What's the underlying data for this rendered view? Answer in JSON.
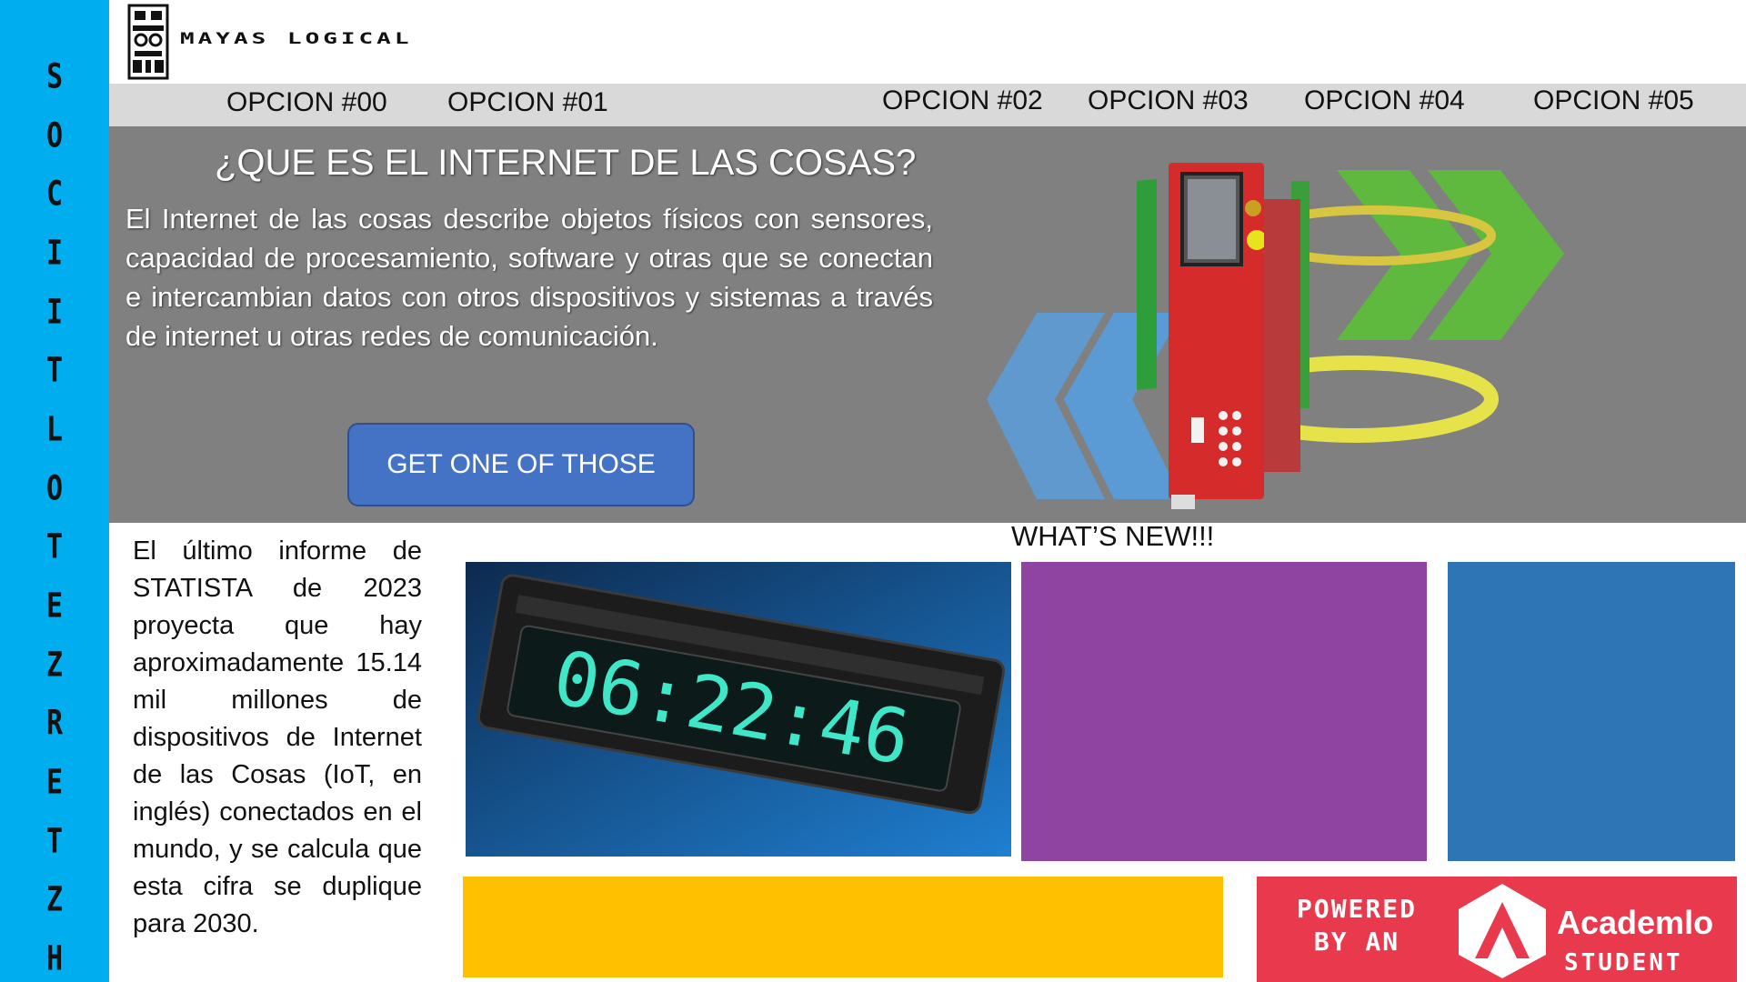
{
  "brand": {
    "name": "MAYAS LOGICAL"
  },
  "sidebar": {
    "letters": [
      "S",
      "O",
      "C",
      "I",
      "I",
      "T",
      "L",
      "O",
      "T",
      "E",
      "Z",
      "R",
      "E",
      "T",
      "Z",
      "H"
    ]
  },
  "nav": {
    "items": [
      {
        "label": "OPCION #00"
      },
      {
        "label": "OPCION #01"
      },
      {
        "label": "OPCION #02"
      },
      {
        "label": "OPCION #03"
      },
      {
        "label": "OPCION #04"
      },
      {
        "label": "OPCION #05"
      }
    ]
  },
  "hero": {
    "title": "¿QUE ES EL INTERNET DE LAS COSAS?",
    "text": "El Internet de las cosas describe objetos físicos con sensores, capacidad de procesamiento, software y otras que se conectan e intercambian datos con otros dispositivos y sistemas a través de internet u otras redes de comunicación.",
    "cta_label": "GET ONE OF THOSE"
  },
  "stats": {
    "text": "El último informe de STATISTA de 2023 proyecta que hay aproximadamente 15.14 mil millones de dispositivos de Internet de las Cosas (IoT, en inglés) conectados en el mundo, y se calcula que esta cifra se duplique para 2030."
  },
  "whats_new": {
    "title": "WHAT’S NEW!!!"
  },
  "clock": {
    "display": "06:22:46"
  },
  "badge": {
    "line1": "POWERED",
    "line2": "BY AN",
    "name": "Academlo",
    "role": "STUDENT"
  },
  "colors": {
    "sidebar": "#00aeef",
    "nav": "#d9d9d9",
    "hero": "#808080",
    "cta": "#4472c4",
    "purple": "#8e44a0",
    "blue": "#2e75b6",
    "yellow": "#ffc000",
    "badge": "#e8394d"
  }
}
